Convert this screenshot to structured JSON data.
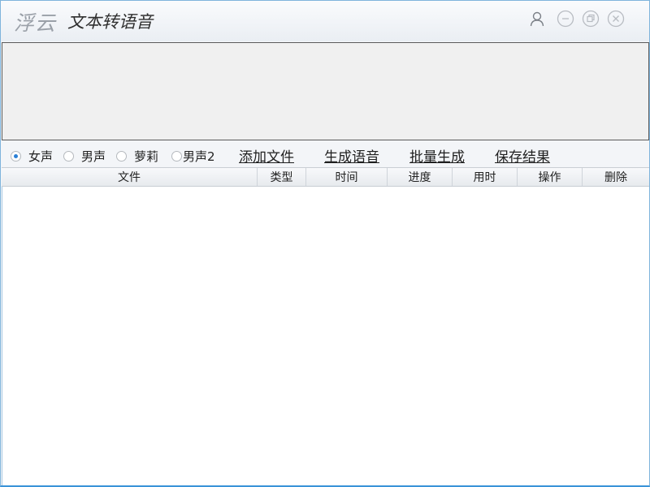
{
  "window": {
    "brand": "浮云",
    "title": "文本转语音"
  },
  "titlebar_buttons": {
    "user": "user-icon",
    "minimize": "minimize-icon",
    "maximize": "restore-icon",
    "close": "close-icon"
  },
  "editor": {
    "value": "",
    "placeholder": ""
  },
  "voices": [
    {
      "label": "女声",
      "checked": true
    },
    {
      "label": "男声",
      "checked": false
    },
    {
      "label": "萝莉",
      "checked": false
    },
    {
      "label": "男声2",
      "checked": false
    }
  ],
  "actions": {
    "add_file": "添加文件",
    "generate": "生成语音",
    "batch": "批量生成",
    "save": "保存结果"
  },
  "table": {
    "columns": [
      "文件",
      "类型",
      "时间",
      "进度",
      "用时",
      "操作",
      "删除"
    ],
    "rows": []
  },
  "colors": {
    "accent": "#2a7fd6",
    "border": "#3a93d8"
  }
}
